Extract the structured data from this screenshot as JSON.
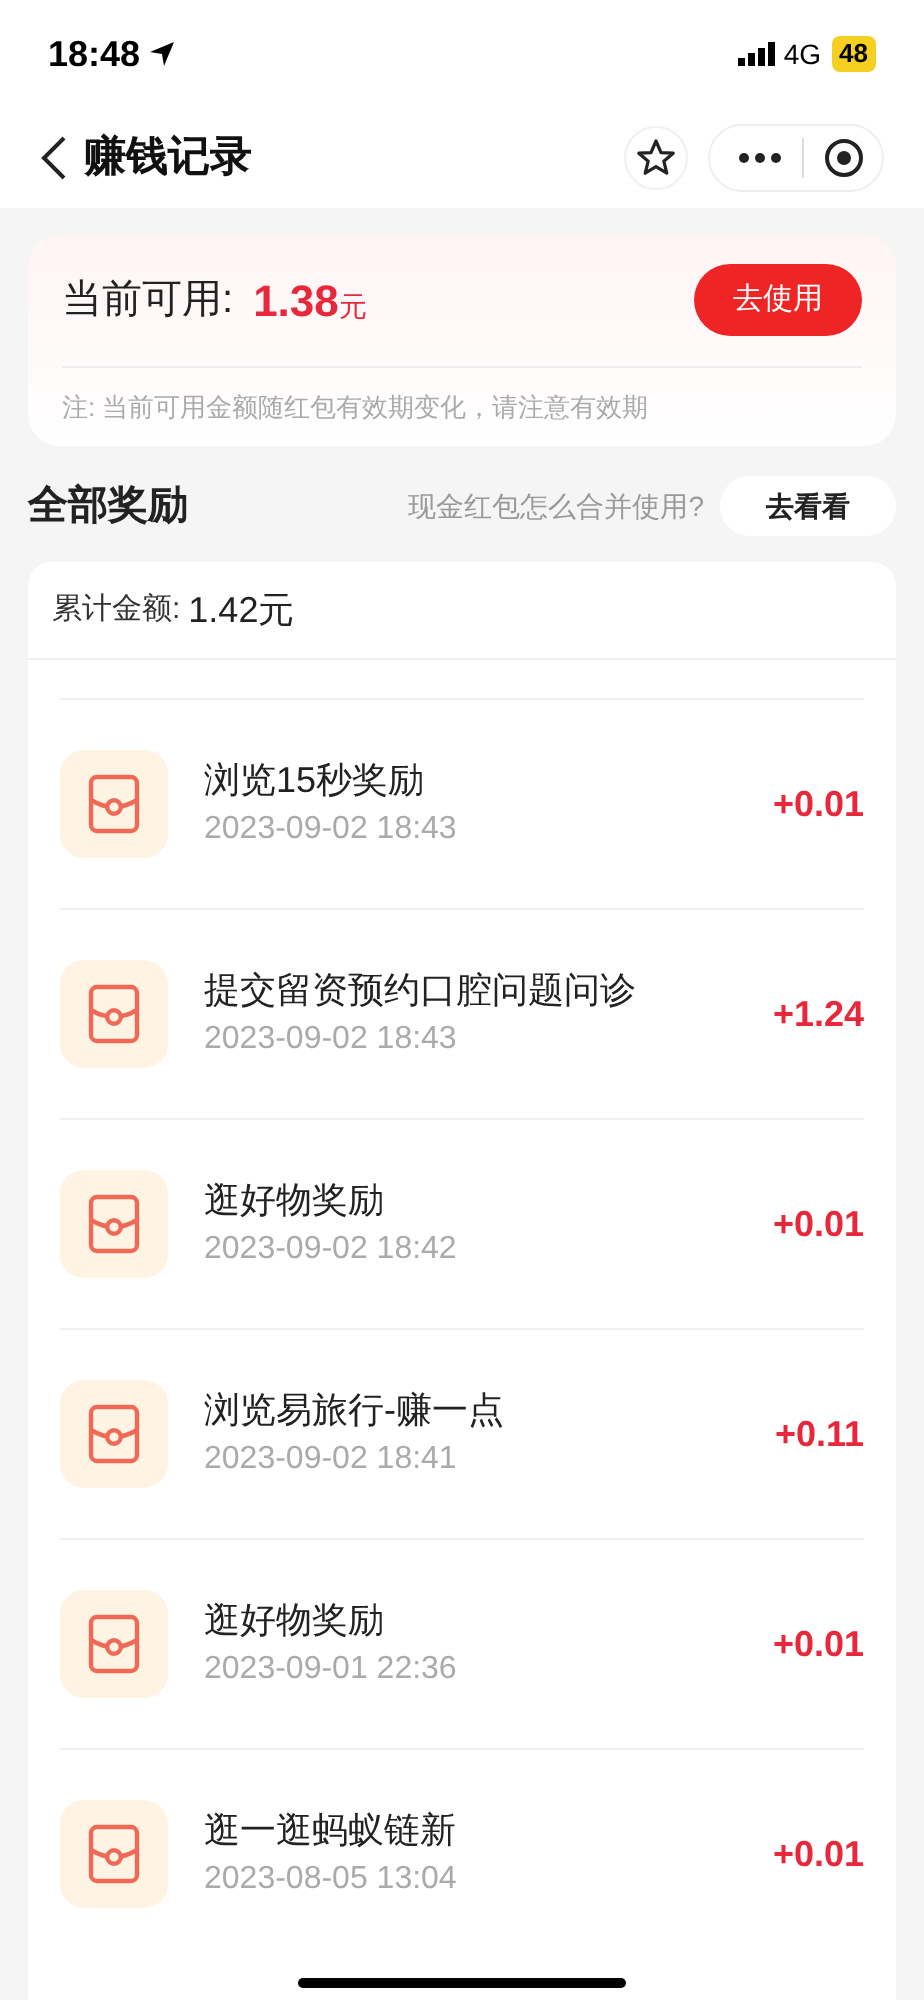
{
  "status_bar": {
    "time": "18:48",
    "network": "4G",
    "battery": "48"
  },
  "nav": {
    "title": "赚钱记录"
  },
  "balance": {
    "label": "当前可用:",
    "amount": "1.38",
    "unit": "元",
    "button": "去使用",
    "note": "注: 当前可用金额随红包有效期变化，请注意有效期"
  },
  "section": {
    "title": "全部奖励",
    "question": "现金红包怎么合并使用?",
    "button": "去看看"
  },
  "total": {
    "label": "累计金额:",
    "value": "1.42元"
  },
  "records": [
    {
      "title": "浏览15秒奖励",
      "time": "2023-09-02 18:43",
      "amount": "+0.01"
    },
    {
      "title": "提交留资预约口腔问题问诊",
      "time": "2023-09-02 18:43",
      "amount": "+1.24"
    },
    {
      "title": "逛好物奖励",
      "time": "2023-09-02 18:42",
      "amount": "+0.01"
    },
    {
      "title": "浏览易旅行-赚一点",
      "time": "2023-09-02 18:41",
      "amount": "+0.11"
    },
    {
      "title": "逛好物奖励",
      "time": "2023-09-01 22:36",
      "amount": "+0.01"
    },
    {
      "title": "逛一逛蚂蚁链新",
      "time": "2023-08-05 13:04",
      "amount": "+0.01"
    }
  ]
}
